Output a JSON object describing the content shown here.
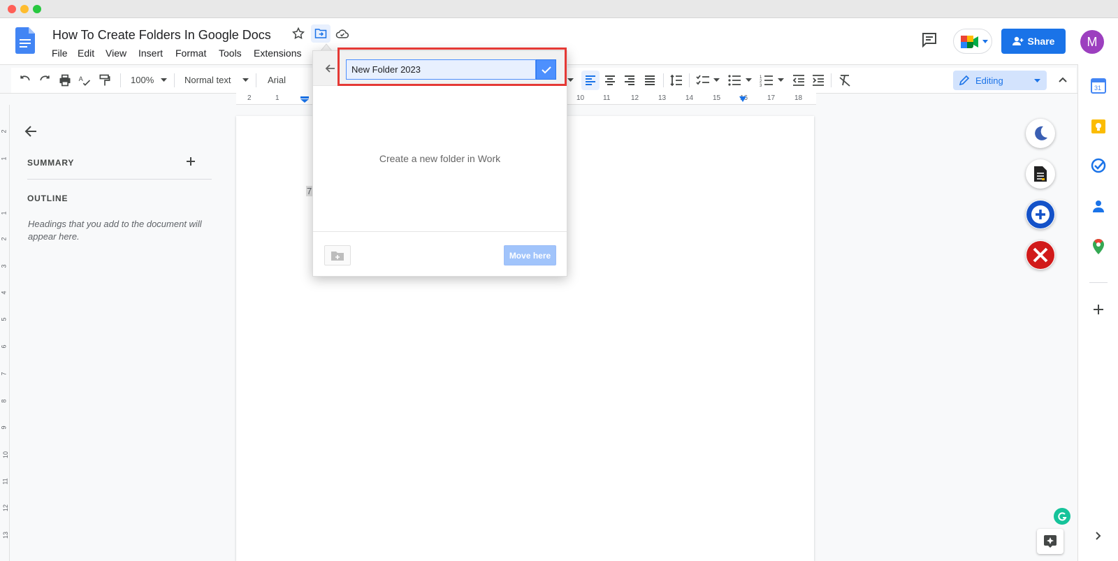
{
  "window": {
    "traffic_lights": [
      "#ff5f57",
      "#febc2e",
      "#28c840"
    ]
  },
  "header": {
    "title": "How To Create Folders In Google Docs",
    "menu": [
      "File",
      "Edit",
      "View",
      "Insert",
      "Format",
      "Tools",
      "Extensions"
    ],
    "share_label": "Share",
    "avatar_initial": "M"
  },
  "toolbar": {
    "zoom": "100%",
    "style": "Normal text",
    "font": "Arial",
    "mode": "Editing"
  },
  "ruler": {
    "top_labels": [
      "2",
      "1",
      "10",
      "11",
      "12",
      "13",
      "14",
      "15",
      "16",
      "17",
      "18"
    ],
    "left_labels": [
      "2",
      "1",
      "1",
      "2",
      "3",
      "4",
      "5",
      "6",
      "7",
      "8",
      "9",
      "10",
      "11",
      "12",
      "13"
    ]
  },
  "outline": {
    "summary_label": "SUMMARY",
    "outline_label": "OUTLINE",
    "hint": "Headings that you add to the document will appear here."
  },
  "page": {
    "fragment_text": "7"
  },
  "move_dialog": {
    "input_value": "New Folder 2023",
    "hint": "Create a new folder in Work",
    "move_button": "Move here"
  },
  "colors": {
    "accent": "#1a73e8",
    "highlight": "#e53935"
  }
}
